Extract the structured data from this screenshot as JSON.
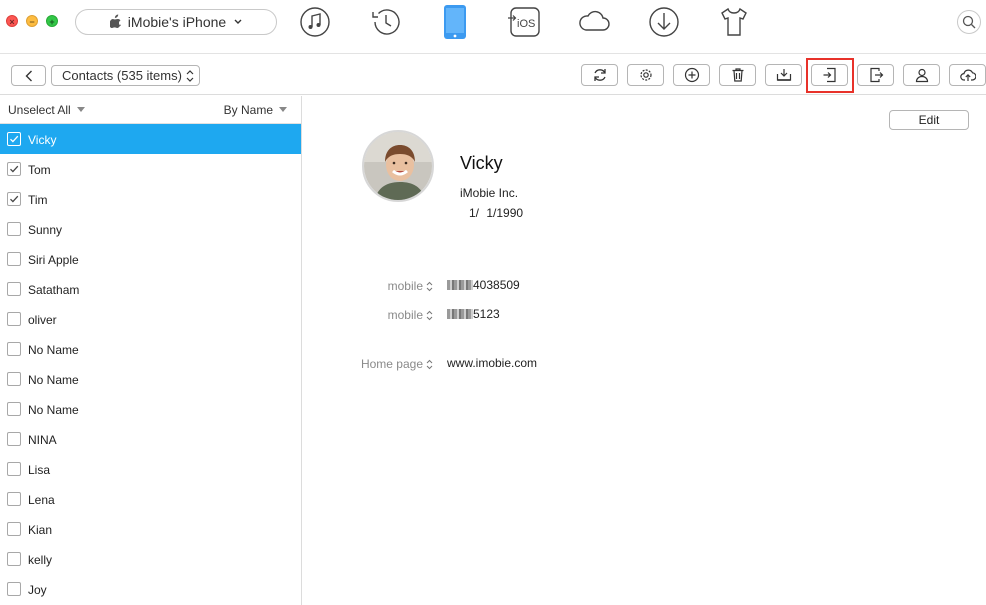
{
  "window": {
    "device_name": "iMobie's iPhone"
  },
  "nav": [
    {
      "icon": "music-icon"
    },
    {
      "icon": "history-icon"
    },
    {
      "icon": "phone-icon"
    },
    {
      "icon": "to-ios-icon",
      "label": "iOS"
    },
    {
      "icon": "cloud-icon"
    },
    {
      "icon": "download-icon"
    },
    {
      "icon": "shirt-icon"
    }
  ],
  "toolbar": {
    "category": "Contacts (535 items)",
    "tools": [
      "refresh-icon",
      "gear-icon",
      "add-icon",
      "trash-icon",
      "to-computer-icon",
      "import-icon",
      "export-icon",
      "contact-icon",
      "cloud-upload-icon"
    ]
  },
  "list": {
    "unselect_label": "Unselect All",
    "sort_label": "By Name",
    "items": [
      {
        "name": "Vicky",
        "checked": true,
        "selected": true
      },
      {
        "name": "Tom",
        "checked": true
      },
      {
        "name": "Tim",
        "checked": true
      },
      {
        "name": "Sunny",
        "checked": false
      },
      {
        "name": "Siri Apple",
        "checked": false
      },
      {
        "name": "Satatham",
        "checked": false
      },
      {
        "name": "oliver",
        "checked": false
      },
      {
        "name": "No Name",
        "checked": false
      },
      {
        "name": "No Name",
        "checked": false
      },
      {
        "name": "No Name",
        "checked": false
      },
      {
        "name": "NINA",
        "checked": false
      },
      {
        "name": "Lisa",
        "checked": false
      },
      {
        "name": "Lena",
        "checked": false
      },
      {
        "name": "Kian",
        "checked": false
      },
      {
        "name": "kelly",
        "checked": false
      },
      {
        "name": "Joy",
        "checked": false
      }
    ]
  },
  "detail": {
    "edit_label": "Edit",
    "name": "Vicky",
    "company": "iMobie Inc.",
    "birthday": "1/ 1/1990",
    "fields": [
      {
        "label": "mobile",
        "value": "4038509"
      },
      {
        "label": "mobile",
        "value": "5123"
      },
      {
        "label": "Home page",
        "value": "www.imobie.com"
      }
    ]
  },
  "colors": {
    "selected_row": "#1ea8f0",
    "highlight_box": "#e8322a",
    "close": "#fc5753",
    "minimize": "#fdbc40",
    "maximize": "#33c748"
  }
}
